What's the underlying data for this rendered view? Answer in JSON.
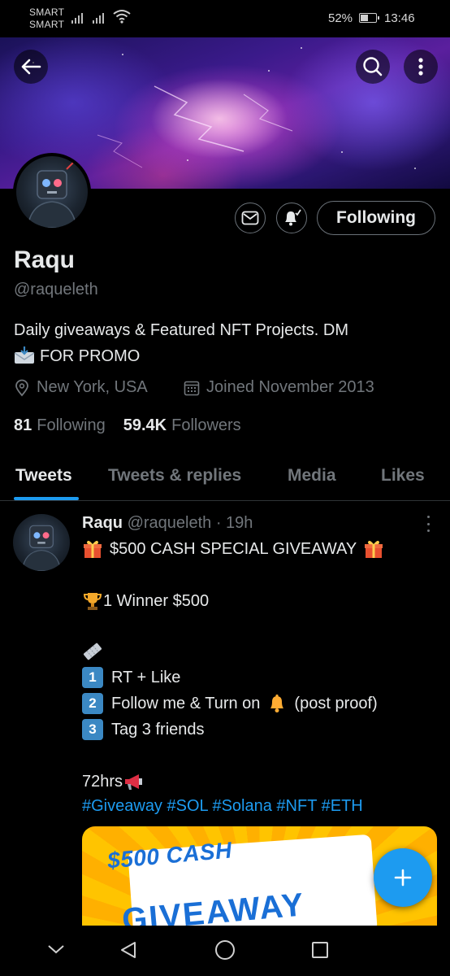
{
  "status_bar": {
    "carrier1": "SMART",
    "carrier2": "SMART",
    "battery_pct": "52%",
    "battery_level": 0.52,
    "time": "13:46"
  },
  "header": {
    "back_icon": "arrow-left-icon",
    "search_icon": "search-icon",
    "more_icon": "more-vertical-icon"
  },
  "profile": {
    "name": "Raqu",
    "handle": "@raqueleth",
    "bio_line1": "Daily giveaways & Featured NFT Projects. DM",
    "bio_line2": "FOR PROMO",
    "location": "New York, USA",
    "joined": "Joined November 2013",
    "following_count": "81",
    "following_label": "Following",
    "followers_count": "59.4K",
    "followers_label": "Followers",
    "follow_button": "Following"
  },
  "tabs": [
    {
      "label": "Tweets",
      "active": true
    },
    {
      "label": "Tweets & replies",
      "active": false
    },
    {
      "label": "Media",
      "active": false
    },
    {
      "label": "Likes",
      "active": false
    }
  ],
  "tweet": {
    "author": "Raqu",
    "handle": "@raqueleth",
    "time": "· 19h",
    "line1": "$500 CASH SPECIAL GIVEAWAY",
    "line2": "1 Winner $500",
    "step1": "RT + Like",
    "step2a": "Follow me & Turn on",
    "step2b": "(post proof)",
    "step3": "Tag 3 friends",
    "duration": "72hrs",
    "hashtags": "#Giveaway #SOL #Solana #NFT #ETH",
    "key1": "1",
    "key2": "2",
    "key3": "3",
    "media_text1": "$500 CASH",
    "media_text2": "GIVEAWAY"
  },
  "colors": {
    "accent": "#1d9bf0",
    "background": "#000000",
    "muted": "#71767b"
  }
}
